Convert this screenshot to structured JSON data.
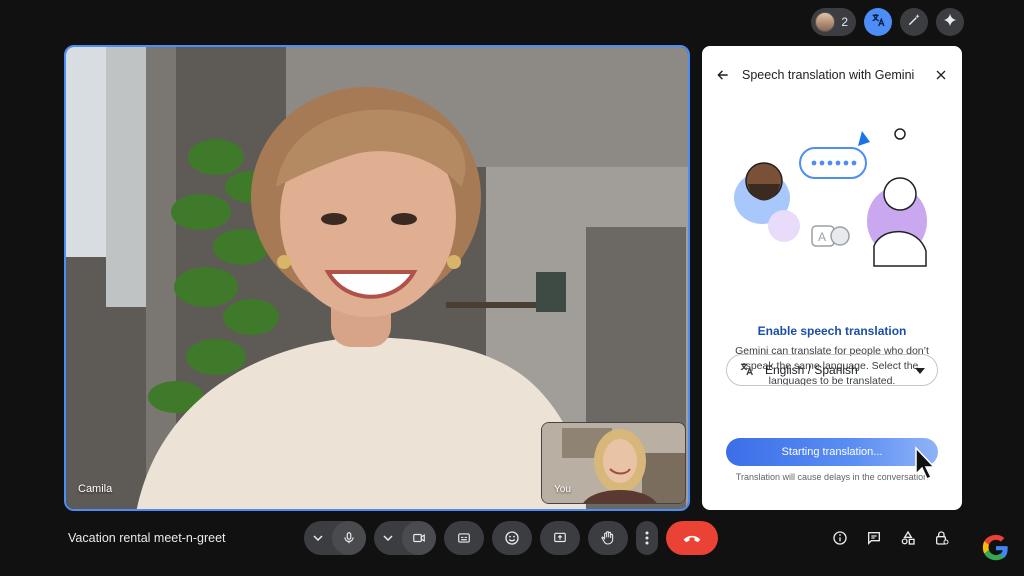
{
  "header": {
    "participant_count": "2"
  },
  "main_video": {
    "name": "Camila"
  },
  "self_video": {
    "name": "You"
  },
  "panel": {
    "title": "Speech translation with Gemini",
    "heading": "Enable speech translation",
    "description": "Gemini can translate for people who don’t speak the same language. Select the languages to be translated.",
    "language_value": "English / Spanish",
    "start_button_label": "Starting translation...",
    "delay_note": "Translation will cause delays in the conversation"
  },
  "footer": {
    "meeting_title": "Vacation rental meet-n-greet"
  },
  "colors": {
    "accent": "#4c8df6",
    "hangup": "#ea4335",
    "panel_heading": "#1a4ea8"
  },
  "icons": [
    "translate-icon",
    "magic-wand-icon",
    "sparkle-icon",
    "back-arrow-icon",
    "close-icon",
    "mic-icon",
    "camera-icon",
    "captions-icon",
    "emoji-icon",
    "present-icon",
    "raise-hand-icon",
    "more-icon",
    "hangup-icon",
    "info-icon",
    "chat-icon",
    "activities-icon",
    "host-controls-icon"
  ]
}
